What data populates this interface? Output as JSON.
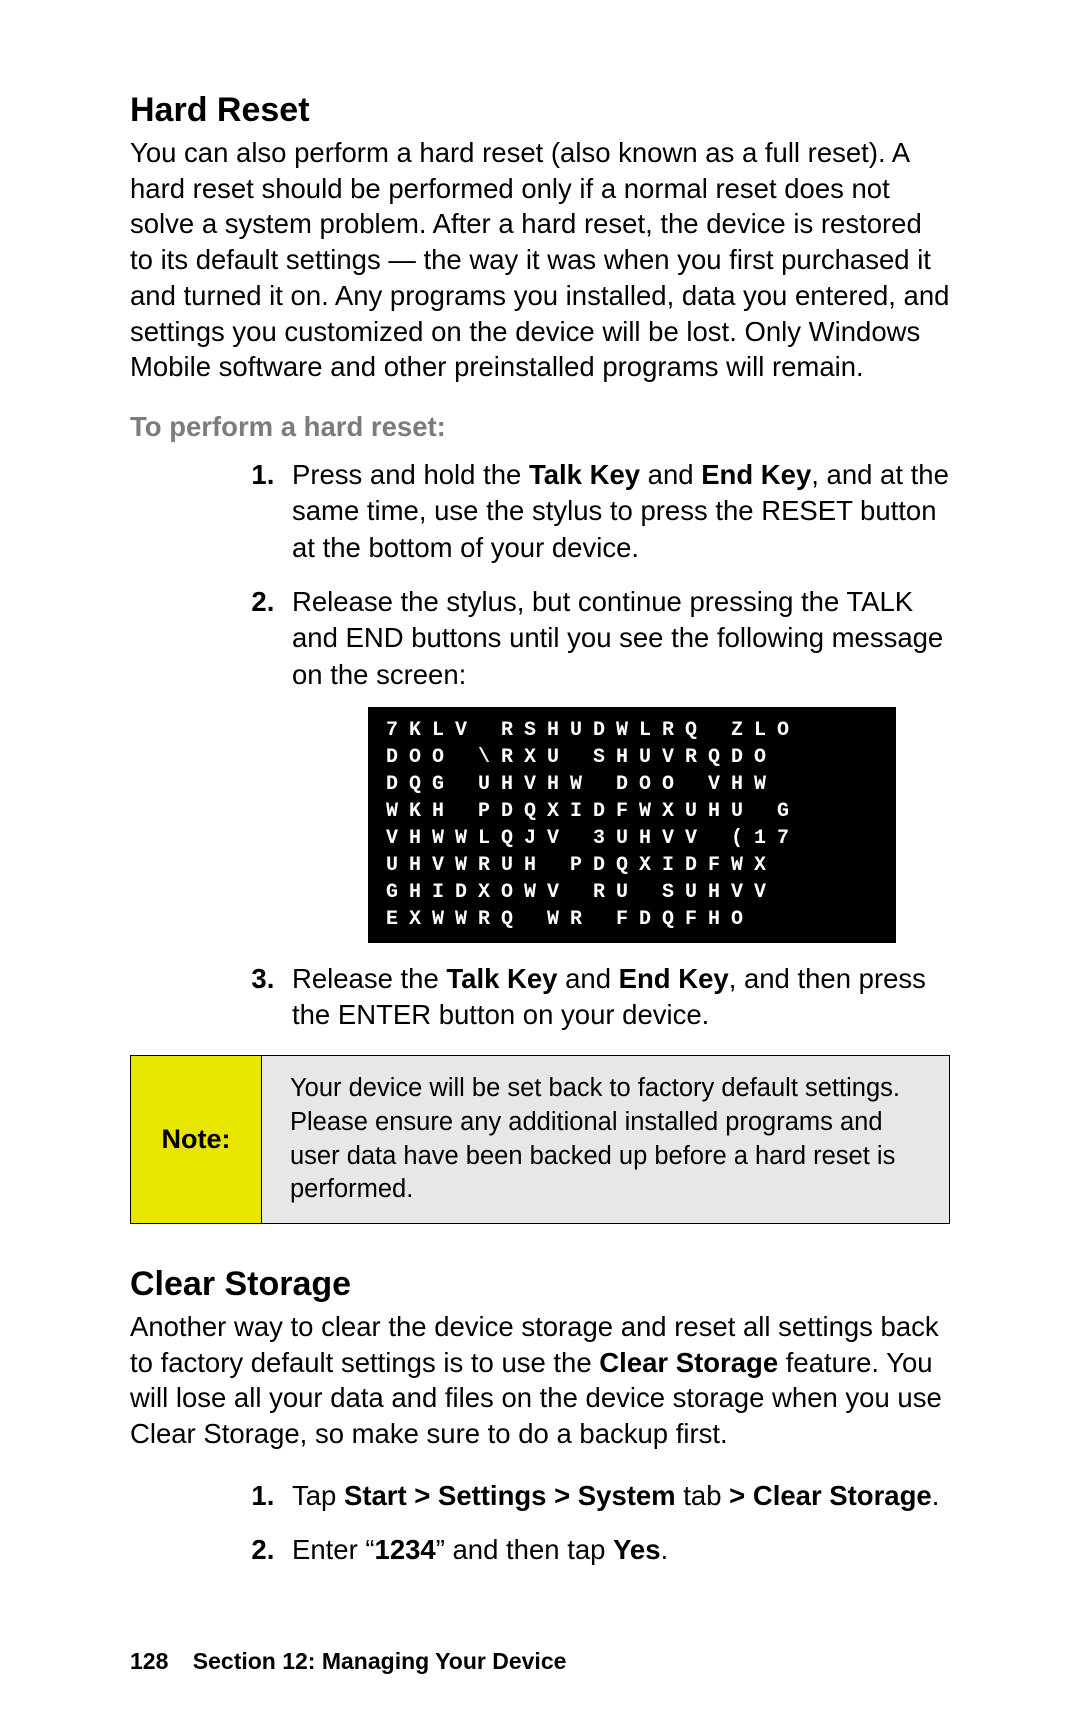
{
  "hardReset": {
    "heading": "Hard Reset",
    "intro": "You can also perform a hard reset (also known as a full reset). A hard reset should be performed only if a normal reset does not solve a system problem. After a hard reset, the device is restored to its default settings — the way it was when you first purchased it and turned it on. Any programs you installed, data you entered, and settings you customized on the device will be lost. Only Windows Mobile software and other preinstalled programs will remain.",
    "procedureHeading": "To perform a hard reset:",
    "step1_pre": "Press and hold the ",
    "step1_b1": "Talk Key",
    "step1_mid1": " and ",
    "step1_b2": "End Key",
    "step1_post": ", and at the same time, use the stylus to press the RESET button at the bottom of your device.",
    "step2": "Release the stylus, but continue pressing the TALK and END buttons until you see the following message on the screen:",
    "screenMsg": {
      "l1": "7KLV RSHUDWLRQ ZLO",
      "l2": "DOO \\RXU SHUVRQDO",
      "l3": "DQG UHVHW DOO VHW",
      "l4": "WKH PDQXIDFWXUHU G",
      "l5": "VHWWLQJV  3UHVV (17",
      "l6": "UHVWRUH PDQXIDFWX",
      "l7": "GHIDXOWV  RU SUHVV",
      "l8": "EXWWRQ WR FDQFHO"
    },
    "step3_pre": "Release the ",
    "step3_b1": "Talk Key",
    "step3_mid1": " and ",
    "step3_b2": "End Key",
    "step3_post": ", and then press the ENTER button on your device."
  },
  "note": {
    "label": "Note:",
    "text": "Your device will be set back to factory default settings. Please ensure any additional installed programs and user data have been backed up before a hard reset is performed."
  },
  "clearStorage": {
    "heading": "Clear Storage",
    "intro_pre": "Another way to clear the device storage and reset all settings back to factory default settings is to use the ",
    "intro_b1": "Clear Storage",
    "intro_post": " feature. You will lose all your data and files on the device storage when you use Clear Storage, so make sure to do a backup first.",
    "step1_pre": "Tap ",
    "step1_b1": "Start > Settings > System",
    "step1_mid": " tab ",
    "step1_b2": "> Clear Storage",
    "step1_post": ".",
    "step2_pre": "Enter “",
    "step2_b1": "1234",
    "step2_mid": "” and then tap ",
    "step2_b2": "Yes",
    "step2_post": "."
  },
  "footer": {
    "pageNum": "128",
    "section": "Section 12: Managing Your Device"
  }
}
